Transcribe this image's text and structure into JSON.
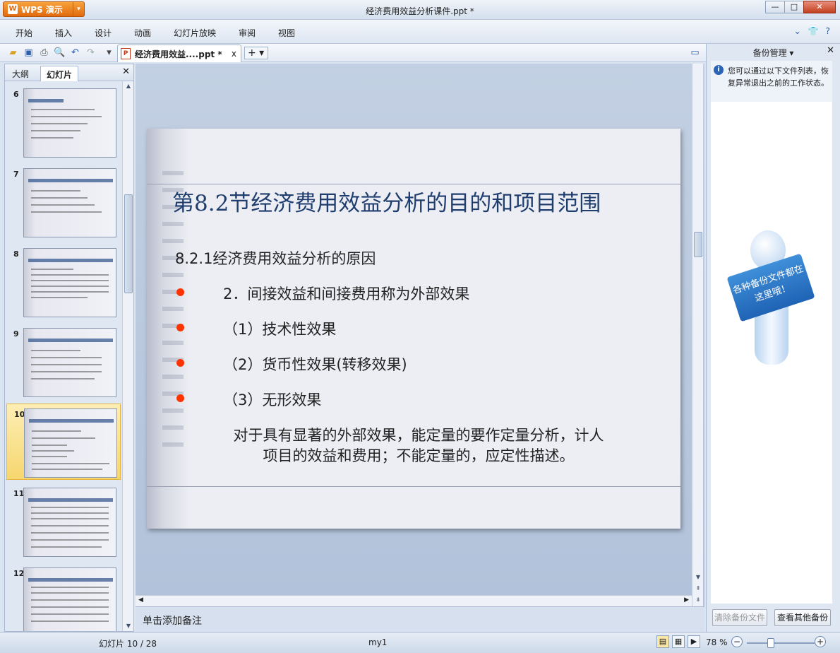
{
  "app": {
    "name": "WPS 演示",
    "logo_letter": "W",
    "window_title": "经济费用效益分析课件.ppt *"
  },
  "window_controls": {
    "minimize": "—",
    "maximize": "□",
    "close": "✕"
  },
  "menu": {
    "items": [
      "开始",
      "插入",
      "设计",
      "动画",
      "幻灯片放映",
      "审阅",
      "视图"
    ],
    "right_icons": [
      "chevron-down-icon",
      "shirt-icon",
      "help-icon"
    ]
  },
  "toolbar": {
    "icons": [
      "open-folder-icon",
      "save-icon",
      "print-icon",
      "print-preview-icon",
      "undo-icon",
      "redo-icon",
      "customize-icon"
    ],
    "doc_tab_label": "经济费用效益....ppt *",
    "doc_tab_close": "x",
    "new_tab": "+"
  },
  "left_panel": {
    "tabs": [
      "大纲",
      "幻灯片"
    ],
    "active_tab": "幻灯片",
    "close": "✕",
    "thumbnails": [
      {
        "num": "6"
      },
      {
        "num": "7"
      },
      {
        "num": "8"
      },
      {
        "num": "9"
      },
      {
        "num": "10",
        "selected": true
      },
      {
        "num": "11"
      },
      {
        "num": "12"
      }
    ]
  },
  "slide": {
    "title": "第8.2节经济费用效益分析的目的和项目范围",
    "subtitle": "8.2.1经济费用效益分析的原因",
    "bullets": [
      "2．间接效益和间接费用称为外部效果",
      "（1）技术性效果",
      "（2）货币性效果(转移效果)",
      "（3）无形效果"
    ],
    "paragraph_line1": "对于具有显著的外部效果，能定量的要作定量分析，计人",
    "paragraph_line2": "项目的效益和费用；不能定量的，应定性描述。",
    "bullet_color": "#ff3300",
    "title_color": "#1f3d6d"
  },
  "notes": {
    "placeholder": "单击添加备注"
  },
  "right_panel": {
    "title": "备份管理",
    "title_arrow": "▾",
    "close": "✕",
    "info_text": "您可以通过以下文件列表，恢复异常退出之前的工作状态。",
    "figure_sign": "各种备份文件都在这里哦！",
    "buttons": [
      "清除备份文件",
      "查看其他备份"
    ]
  },
  "status": {
    "slide_counter": "幻灯片 10 / 28",
    "template_name": "my1",
    "zoom": "78 %",
    "zoom_fraction": 0.78
  }
}
